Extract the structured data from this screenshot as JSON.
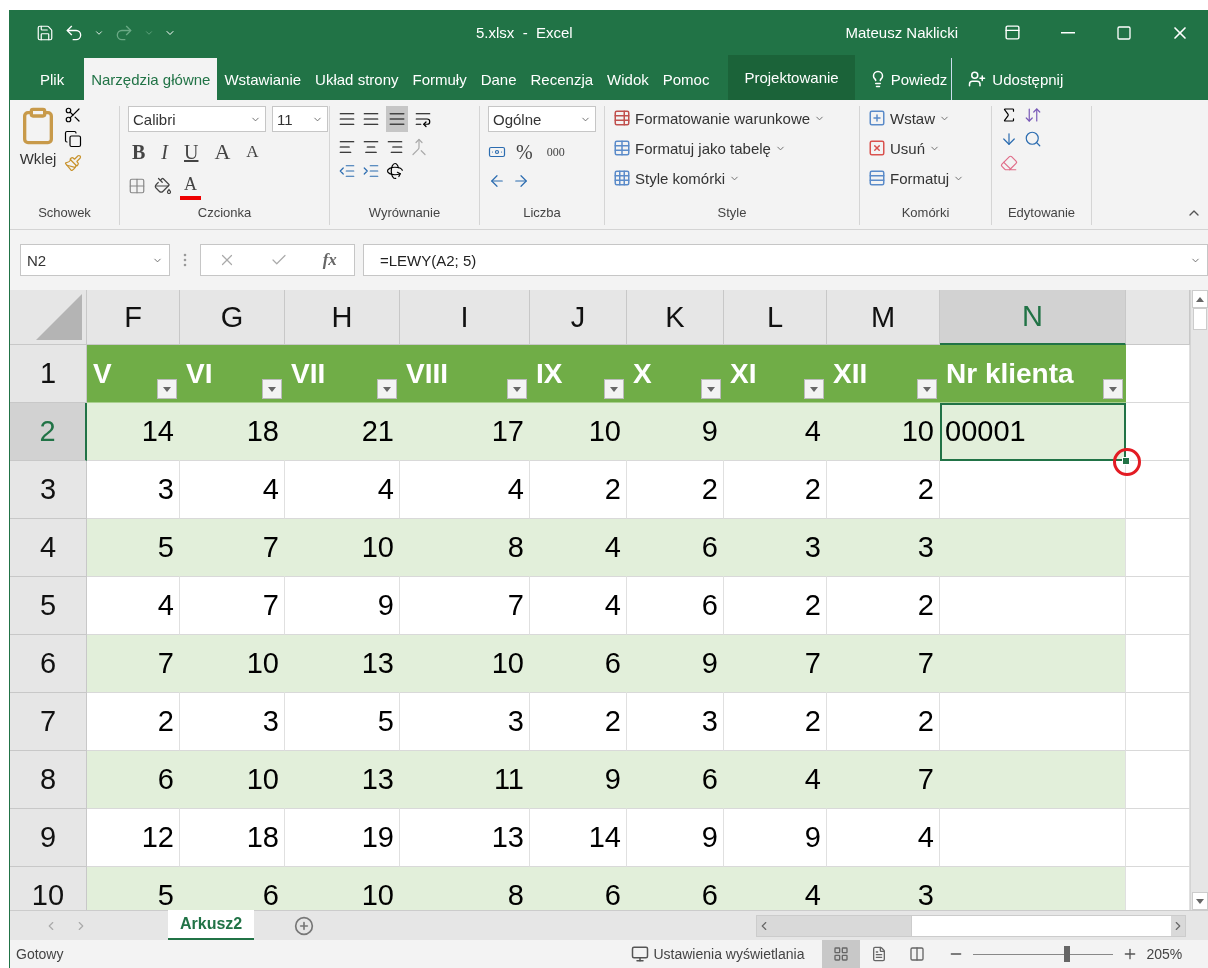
{
  "window": {
    "title": "5.xlsx  -  Excel",
    "user": "Mateusz Naklicki"
  },
  "ribbon_tabs": [
    {
      "label": "Plik",
      "selected": false,
      "kind": "file"
    },
    {
      "label": "Narzędzia główne",
      "selected": true,
      "kind": "tab"
    },
    {
      "label": "Wstawianie",
      "selected": false,
      "kind": "tab"
    },
    {
      "label": "Układ strony",
      "selected": false,
      "kind": "tab"
    },
    {
      "label": "Formuły",
      "selected": false,
      "kind": "tab"
    },
    {
      "label": "Dane",
      "selected": false,
      "kind": "tab"
    },
    {
      "label": "Recenzja",
      "selected": false,
      "kind": "tab"
    },
    {
      "label": "Widok",
      "selected": false,
      "kind": "tab"
    },
    {
      "label": "Pomoc",
      "selected": false,
      "kind": "tab"
    },
    {
      "label": "Projektowanie",
      "selected": false,
      "kind": "contextual"
    }
  ],
  "tell_me": {
    "placeholder": "Powiedz"
  },
  "share": "Udostępnij",
  "ribbon": {
    "clipboard": {
      "label": "Schowek",
      "paste": "Wklej"
    },
    "font": {
      "label": "Czcionka",
      "family": "Calibri",
      "size": "11",
      "bold": "B",
      "italic": "I",
      "underline": "U",
      "grow": "A",
      "shrink": "A",
      "font_color": "A"
    },
    "alignment": {
      "label": "Wyrównanie"
    },
    "number": {
      "label": "Liczba",
      "format": "Ogólne",
      "percent": "%",
      "thousands": "000"
    },
    "styles": {
      "label": "Style",
      "commands": [
        "Formatowanie warunkowe",
        "Formatuj jako tabelę",
        "Style komórki"
      ]
    },
    "cells": {
      "label": "Komórki",
      "commands": [
        "Wstaw",
        "Usuń",
        "Formatuj"
      ]
    },
    "editing": {
      "label": "Edytowanie"
    }
  },
  "formula_bar": {
    "name_box": "N2",
    "function_label": "fx",
    "formula": "=LEWY(A2; 5)"
  },
  "sheet": {
    "columns": [
      {
        "label": "F",
        "selected": false
      },
      {
        "label": "G",
        "selected": false
      },
      {
        "label": "H",
        "selected": false
      },
      {
        "label": "I",
        "selected": false
      },
      {
        "label": "J",
        "selected": false
      },
      {
        "label": "K",
        "selected": false
      },
      {
        "label": "L",
        "selected": false
      },
      {
        "label": "M",
        "selected": false
      },
      {
        "label": "N",
        "selected": true
      }
    ],
    "header_row": {
      "number": "1",
      "selected": false,
      "headers": [
        "V",
        "VI",
        "VII",
        "VIII",
        "IX",
        "X",
        "XI",
        "XII",
        "Nr klienta"
      ]
    },
    "rows": [
      {
        "number": "2",
        "selected": true,
        "cells": [
          "14",
          "18",
          "21",
          "17",
          "10",
          "9",
          "4",
          "10",
          "00001"
        ]
      },
      {
        "number": "3",
        "selected": false,
        "cells": [
          "3",
          "4",
          "4",
          "4",
          "2",
          "2",
          "2",
          "2"
        ]
      },
      {
        "number": "4",
        "selected": false,
        "cells": [
          "5",
          "7",
          "10",
          "8",
          "4",
          "6",
          "3",
          "3"
        ]
      },
      {
        "number": "5",
        "selected": false,
        "cells": [
          "4",
          "7",
          "9",
          "7",
          "4",
          "6",
          "2",
          "2"
        ]
      },
      {
        "number": "6",
        "selected": false,
        "cells": [
          "7",
          "10",
          "13",
          "10",
          "6",
          "9",
          "7",
          "7"
        ]
      },
      {
        "number": "7",
        "selected": false,
        "cells": [
          "2",
          "3",
          "5",
          "3",
          "2",
          "3",
          "2",
          "2"
        ]
      },
      {
        "number": "8",
        "selected": false,
        "cells": [
          "6",
          "10",
          "13",
          "11",
          "9",
          "6",
          "4",
          "7"
        ]
      },
      {
        "number": "9",
        "selected": false,
        "cells": [
          "12",
          "18",
          "19",
          "13",
          "14",
          "9",
          "9",
          "4"
        ]
      },
      {
        "number": "10",
        "selected": false,
        "cells": [
          "5",
          "6",
          "10",
          "8",
          "6",
          "6",
          "4",
          "3"
        ]
      }
    ]
  },
  "sheet_tabs": [
    {
      "label": "Arkusz2",
      "selected": true
    }
  ],
  "status_bar": {
    "state": "Gotowy",
    "display_settings": "Ustawienia wyświetlania",
    "views": [
      {
        "kind": "normal",
        "selected": true
      },
      {
        "kind": "page_layout",
        "selected": false
      },
      {
        "kind": "page_break",
        "selected": false
      }
    ],
    "zoom": {
      "level": 0.67,
      "reading": "205%"
    }
  }
}
